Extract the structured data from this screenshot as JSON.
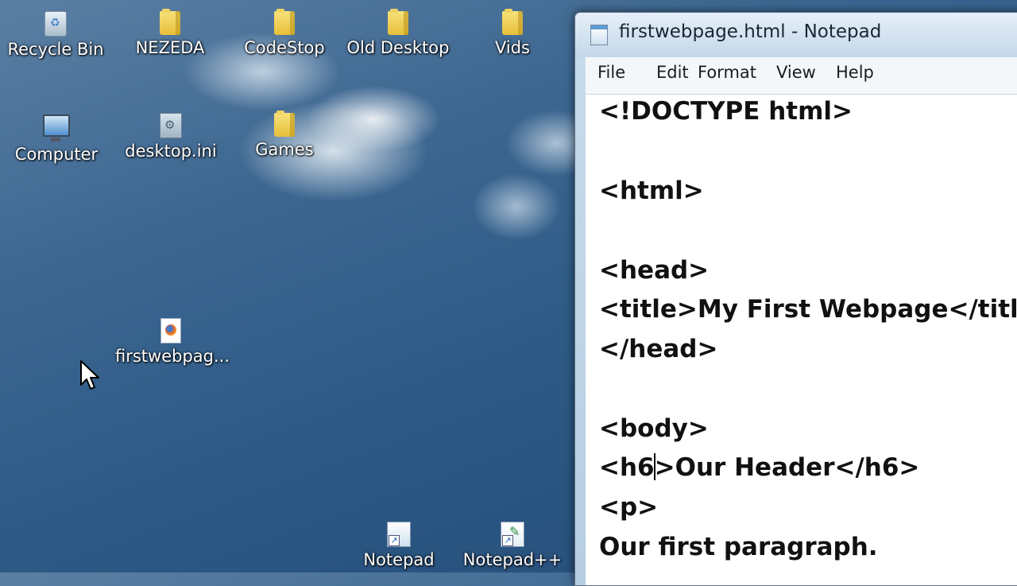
{
  "desktop": {
    "icons": [
      {
        "label": "Recycle Bin",
        "icon": "recycle-bin-icon"
      },
      {
        "label": "NEZEDA",
        "icon": "folder-icon"
      },
      {
        "label": "CodeStop",
        "icon": "folder-icon"
      },
      {
        "label": "Old Desktop",
        "icon": "folder-icon"
      },
      {
        "label": "Vids",
        "icon": "folder-icon"
      },
      {
        "label": "Computer",
        "icon": "computer-icon"
      },
      {
        "label": "desktop.ini",
        "icon": "settings-file-icon"
      },
      {
        "label": "Games",
        "icon": "folder-icon"
      },
      {
        "label": "firstwebpag...",
        "icon": "firefox-document-icon"
      },
      {
        "label": "Notepad",
        "icon": "shortcut-icon"
      },
      {
        "label": "Notepad++",
        "icon": "notepadpp-shortcut-icon"
      }
    ]
  },
  "notepad": {
    "title": "firstwebpage.html - Notepad",
    "menu": [
      "File",
      "Edit",
      "Format",
      "View",
      "Help"
    ],
    "lines": [
      "<!DOCTYPE html>",
      "",
      "<html>",
      "",
      "<head>",
      "<title>My First Webpage</title>",
      "</head>",
      "",
      "<body>",
      "<h6",
      ">Our Header</h6>",
      "<p>",
      "Our first paragraph."
    ]
  }
}
